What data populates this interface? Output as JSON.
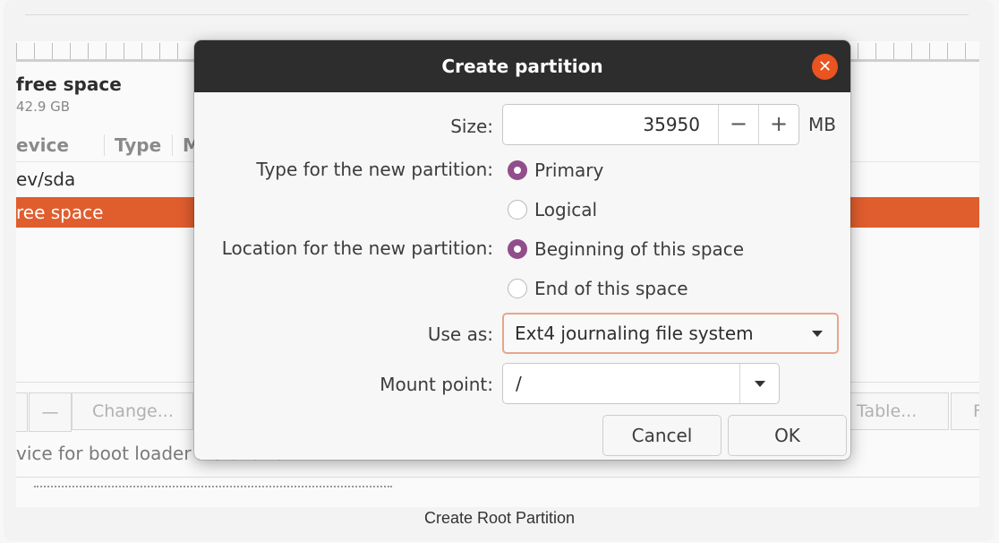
{
  "background": {
    "free_space_title": "free space",
    "free_space_size": "42.9 GB",
    "columns": [
      "evice",
      "Type",
      "M"
    ],
    "rows": [
      "ev/sda",
      "ree space"
    ],
    "toolbar": [
      "—",
      "Change...",
      "Table...",
      "F"
    ],
    "boot_loader_label": "vice for boot loader installation:"
  },
  "dialog": {
    "title": "Create partition",
    "close_glyph": "✕",
    "size_label": "Size:",
    "size_value": "35950",
    "decrement_glyph": "−",
    "increment_glyph": "+",
    "size_unit": "MB",
    "type_label": "Type for the new partition:",
    "type_options": [
      "Primary",
      "Logical"
    ],
    "type_selected": "Primary",
    "location_label": "Location for the new partition:",
    "location_options": [
      "Beginning of this space",
      "End of this space"
    ],
    "location_selected": "Beginning of this space",
    "use_as_label": "Use as:",
    "use_as_value": "Ext4 journaling file system",
    "mount_label": "Mount point:",
    "mount_value": "/",
    "cancel_label": "Cancel",
    "ok_label": "OK"
  },
  "caption": "Create Root Partition",
  "colors": {
    "accent": "#e95420",
    "selected_row": "#e05d2e",
    "radio_selected": "#924d8b",
    "titlebar": "#2d2d2d"
  },
  "icons": [
    "close-icon",
    "chevron-down-icon"
  ]
}
